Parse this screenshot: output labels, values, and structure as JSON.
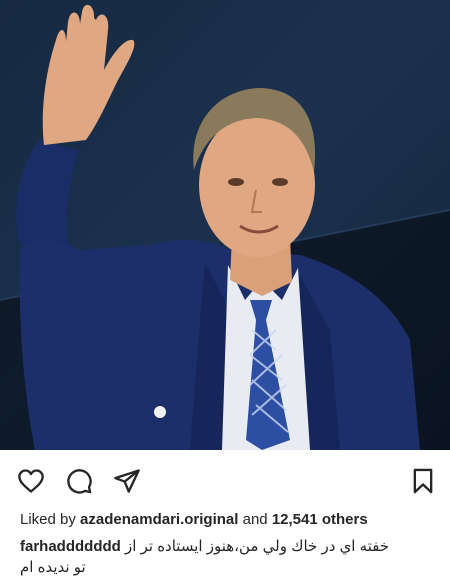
{
  "post": {
    "image_alt": "man in navy suit waving",
    "actions": {
      "like_icon": "heart-icon",
      "comment_icon": "comment-icon",
      "share_icon": "send-icon",
      "save_icon": "bookmark-icon"
    },
    "likes": {
      "prefix": "Liked by",
      "user": "azadenamdari.original",
      "middle": "and",
      "count": "12,541 others"
    },
    "caption": {
      "username": "farhaddddddd",
      "line1": "خفته اي در خاك ولي من،هنوز ايستاده تر از",
      "line2": "تو نديده ام"
    }
  },
  "colors": {
    "text": "#262626",
    "suit": "#1c2f6b",
    "background_dark": "#0d1b2a"
  }
}
